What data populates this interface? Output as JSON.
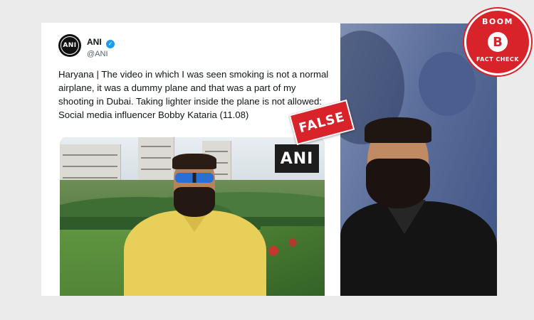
{
  "tweet": {
    "avatar_text": "ANI",
    "display_name": "ANI",
    "handle": "@ANI",
    "text": "Haryana | The video in which I was seen smoking is not a normal airplane, it was a dummy plane and that was a part of my shooting in Dubai. Taking lighter inside the plane is not allowed: Social media influencer Bobby Kataria (11.08)",
    "media_watermark": "ANI"
  },
  "stamp": {
    "label": "FALSE"
  },
  "logo": {
    "top": "BOOM",
    "letter": "B",
    "bottom": "FACT CHECK"
  },
  "colors": {
    "brand_red": "#d8232a",
    "verified_blue": "#1d9bf0",
    "background": "#ebebeb"
  }
}
